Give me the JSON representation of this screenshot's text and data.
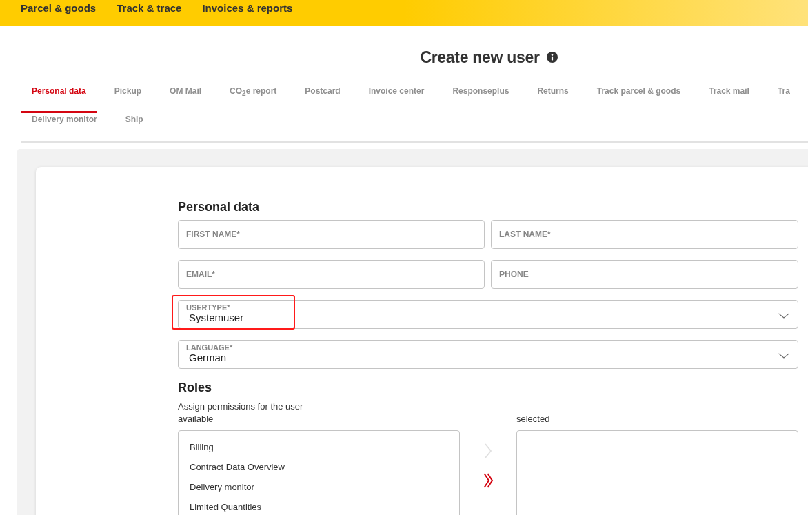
{
  "header": {
    "nav": [
      "Parcel & goods",
      "Track & trace",
      "Invoices & reports"
    ]
  },
  "page": {
    "title": "Create new user"
  },
  "tabs": {
    "rows": [
      [
        {
          "label": "Personal data",
          "selected": true,
          "disabled": false
        },
        {
          "label": "Pickup",
          "selected": false,
          "disabled": true
        },
        {
          "label": "OM Mail",
          "selected": false,
          "disabled": true
        },
        {
          "label": "CO$_{2}$e report",
          "selected": false,
          "disabled": true
        },
        {
          "label": "Postcard",
          "selected": false,
          "disabled": true
        },
        {
          "label": "Invoice center",
          "selected": false,
          "disabled": true
        },
        {
          "label": "Responseplus",
          "selected": false,
          "disabled": true
        },
        {
          "label": "Returns",
          "selected": false,
          "disabled": true
        },
        {
          "label": "Track parcel & goods",
          "selected": false,
          "disabled": true
        },
        {
          "label": "Track mail",
          "selected": false,
          "disabled": true
        },
        {
          "label": "Tra",
          "selected": false,
          "disabled": true
        }
      ],
      [
        {
          "label": "Delivery monitor",
          "selected": false,
          "disabled": true
        },
        {
          "label": "Ship",
          "selected": false,
          "disabled": true
        }
      ]
    ]
  },
  "personal_data": {
    "heading": "Personal data",
    "fields": [
      {
        "kind": "text",
        "placeholder": "FIRST NAME*",
        "highlighted": false
      },
      {
        "kind": "text",
        "placeholder": "LAST NAME*",
        "highlighted": false
      },
      {
        "kind": "text",
        "placeholder": "EMAIL*",
        "highlighted": false
      },
      {
        "kind": "text",
        "placeholder": "PHONE",
        "highlighted": false
      },
      {
        "kind": "select",
        "label": "USERTYPE*",
        "value": "Systemuser",
        "highlighted": true
      },
      {
        "kind": "select",
        "label": "LANGUAGE*",
        "value": "German",
        "highlighted": false
      }
    ]
  },
  "roles": {
    "heading": "Roles",
    "description": "Assign permissions for the user",
    "available": {
      "label": "available",
      "items": [
        {
          "label": "Billing",
          "selected": false
        },
        {
          "label": "Contract Data Overview",
          "selected": false
        },
        {
          "label": "Delivery monitor",
          "selected": false
        },
        {
          "label": "Limited Quantities",
          "selected": false
        }
      ]
    },
    "transfer_buttons": [
      {
        "kind": "move-selected",
        "disabled": true
      },
      {
        "kind": "move-all",
        "disabled": false
      }
    ],
    "selected": {
      "label": "selected"
    }
  }
}
